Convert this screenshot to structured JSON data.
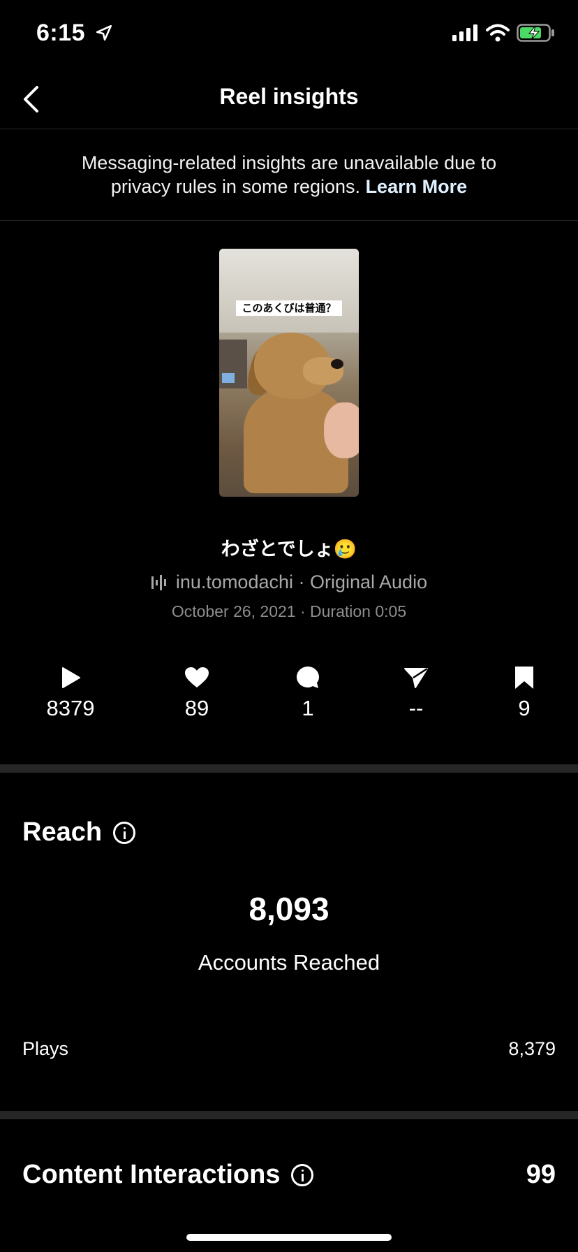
{
  "status_bar": {
    "time": "6:15"
  },
  "header": {
    "title": "Reel insights"
  },
  "notice": {
    "text": "Messaging-related insights are unavailable due to privacy rules in some regions.",
    "link": "Learn More"
  },
  "reel": {
    "overlay_text": "このあくびは普通？",
    "caption": "わざとでしょ🥲",
    "audio": "inu.tomodachi · Original Audio",
    "meta": "October 26, 2021 · Duration 0:05"
  },
  "stats": [
    {
      "icon": "play-icon",
      "value": "8379"
    },
    {
      "icon": "heart-icon",
      "value": "89"
    },
    {
      "icon": "comment-icon",
      "value": "1"
    },
    {
      "icon": "share-icon",
      "value": "--"
    },
    {
      "icon": "bookmark-icon",
      "value": "9"
    }
  ],
  "reach": {
    "title": "Reach",
    "value": "8,093",
    "label": "Accounts Reached",
    "plays_label": "Plays",
    "plays_value": "8,379"
  },
  "content_interactions": {
    "title": "Content Interactions",
    "value": "99"
  }
}
